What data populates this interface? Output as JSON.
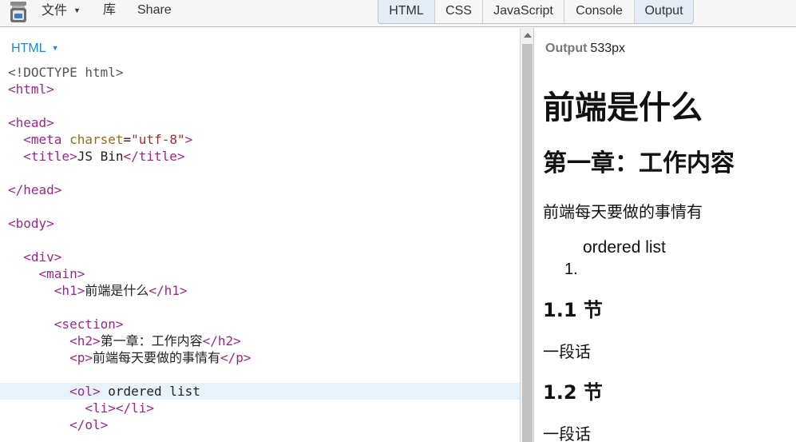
{
  "menu": {
    "file_label": "文件",
    "file_caret": "▼",
    "library_label": "库",
    "share_label": "Share"
  },
  "tabs": [
    {
      "label": "HTML",
      "active": true
    },
    {
      "label": "CSS",
      "active": false
    },
    {
      "label": "JavaScript",
      "active": false
    },
    {
      "label": "Console",
      "active": false
    },
    {
      "label": "Output",
      "active": true
    }
  ],
  "editor": {
    "panel_label": "HTML",
    "panel_caret": "▼",
    "lines": [
      "<!DOCTYPE html>",
      "<html>",
      "",
      "<head>",
      "  <meta charset=\"utf-8\">",
      "  <title>JS Bin</title>",
      "",
      "</head>",
      "",
      "<body>",
      "",
      "  <div>",
      "    <main>",
      "      <h1>前端是什么</h1>",
      "",
      "      <section>",
      "        <h2>第一章：工作内容</h2>",
      "        <p>前端每天要做的事情有</p>",
      "",
      "        <ol> ordered list",
      "          <li></li>",
      "        </ol>"
    ],
    "highlighted_line": 19
  },
  "output": {
    "label_name": "Output",
    "label_width": "533px",
    "h1": "前端是什么",
    "h2": "第一章：工作内容",
    "p1": "前端每天要做的事情有",
    "ol_text": "ordered list",
    "li_marker": "1.",
    "h3a": "1.1 节",
    "p2": "一段话",
    "h3b": "1.2 节",
    "p3": "一段话"
  }
}
